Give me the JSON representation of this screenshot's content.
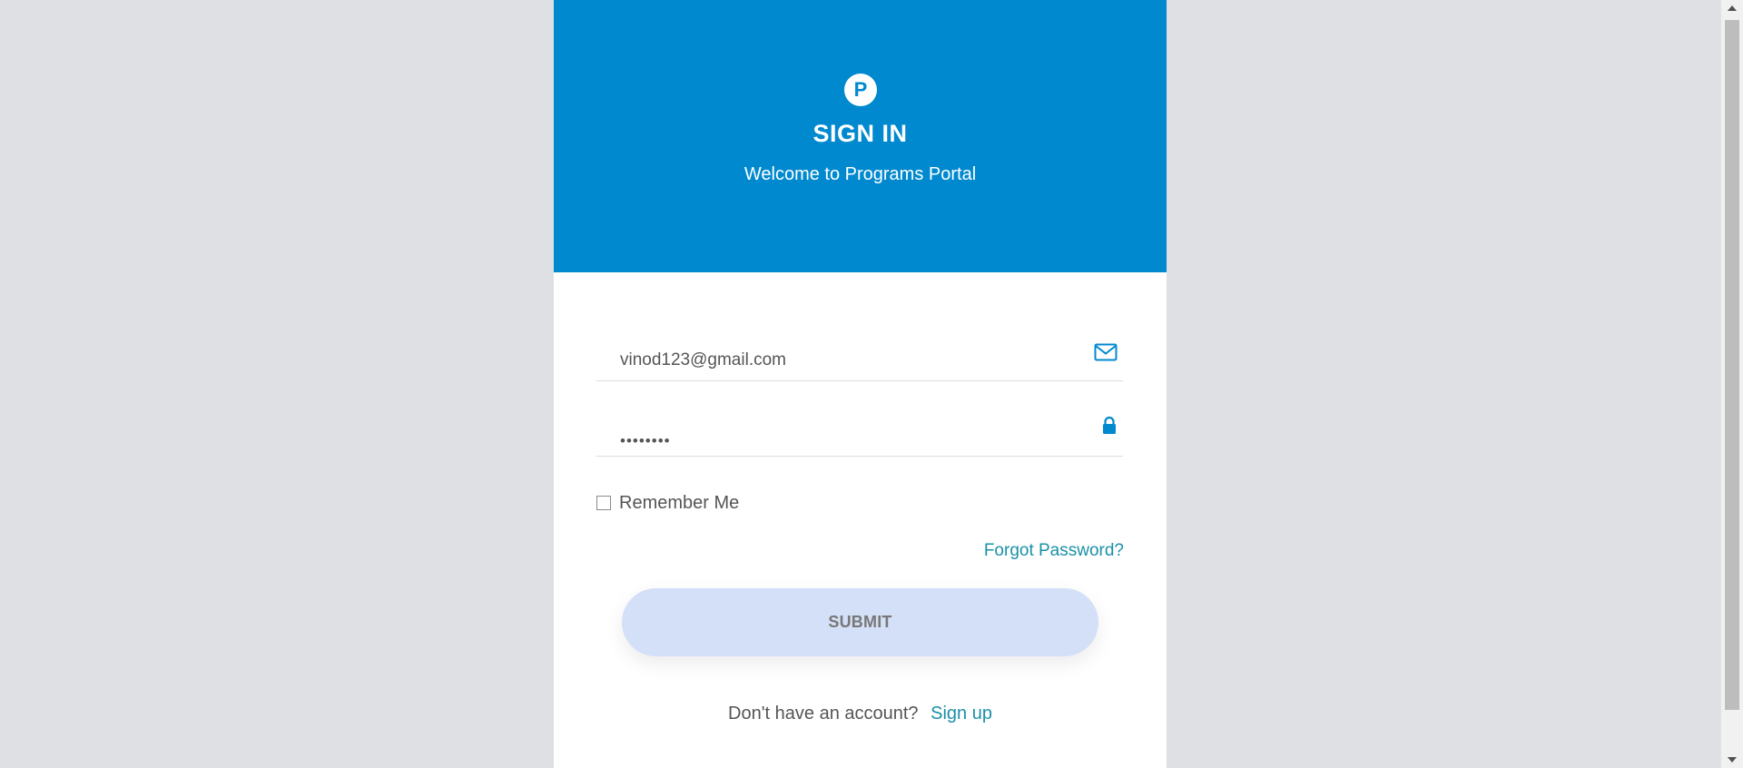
{
  "header": {
    "logo_letter": "P",
    "title": "SIGN IN",
    "subtitle": "Welcome to Programs Portal"
  },
  "form": {
    "email_value": "vinod123@gmail.com",
    "password_value": "••••••••",
    "email_icon": "envelope-icon",
    "password_icon": "lock-icon",
    "remember_label": "Remember Me",
    "remember_checked": false,
    "forgot_label": "Forgot Password?",
    "submit_label": "SUBMIT"
  },
  "footer": {
    "prompt": "Don't have an account?",
    "signup_label": "Sign up"
  },
  "colors": {
    "accent": "#0089cf",
    "link": "#1a90a8",
    "page_bg": "#dfe0e3",
    "submit_bg": "#d4e0f7"
  }
}
